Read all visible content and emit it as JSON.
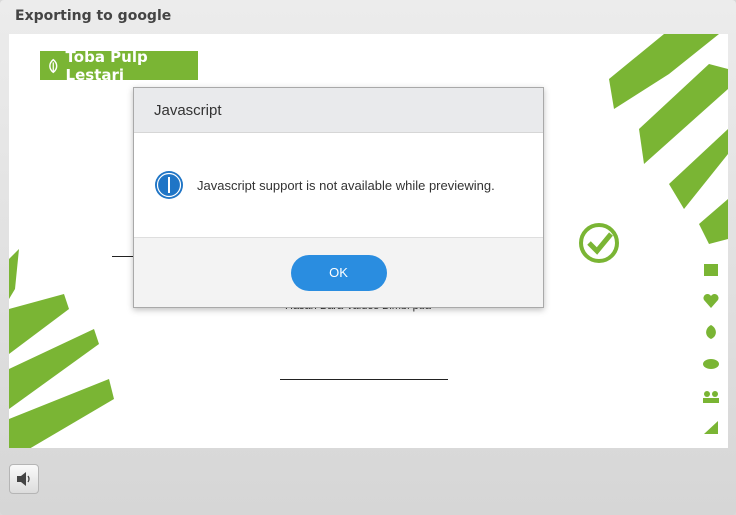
{
  "window": {
    "title": "Exporting to google"
  },
  "slide": {
    "logo_text": "Toba Pulp Lestari",
    "faded_text": "Hasan Bara Valdes Bimbi pua",
    "brand_color": "#7ab534"
  },
  "dialog": {
    "title": "Javascript",
    "message": "Javascript support is not available while previewing.",
    "ok_label": "OK",
    "info_icon": "info-icon",
    "button_color": "#2a8de0"
  },
  "controls": {
    "audio_icon": "speaker-icon"
  }
}
